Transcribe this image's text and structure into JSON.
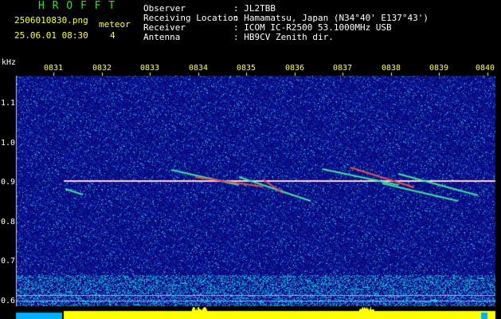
{
  "header": {
    "app_name": "H R O F F T",
    "filename": "2506010830.png",
    "datetime": "25.06.01 08:30",
    "meteor_label": "meteor",
    "meteor_count": "4",
    "fields": [
      {
        "label": "Observer",
        "value": ": JL2TBB"
      },
      {
        "label": "Receiving Location",
        "value": ": Hamamatsu, Japan (N34°40' E137°43')"
      },
      {
        "label": "Receiver",
        "value": ": ICOM IC-R2500 53.1000MHz USB"
      },
      {
        "label": "Antenna",
        "value": ": HB9CV Zenith dir."
      }
    ]
  },
  "axes": {
    "y_unit": "kHz",
    "y_ticks": [
      "1.1",
      "1.0",
      "0.9",
      "0.8",
      "0.7",
      "0.6"
    ],
    "x_ticks": [
      "0831",
      "0832",
      "0833",
      "0834",
      "0835",
      "0836",
      "0837",
      "0838",
      "0839",
      "0840"
    ]
  },
  "colors": {
    "background": "#0a0a6e",
    "title_green": "#2fe02f",
    "text_yellow": "#ffff33",
    "baseline": "#ffff00",
    "carrier": "#ffffff"
  }
}
